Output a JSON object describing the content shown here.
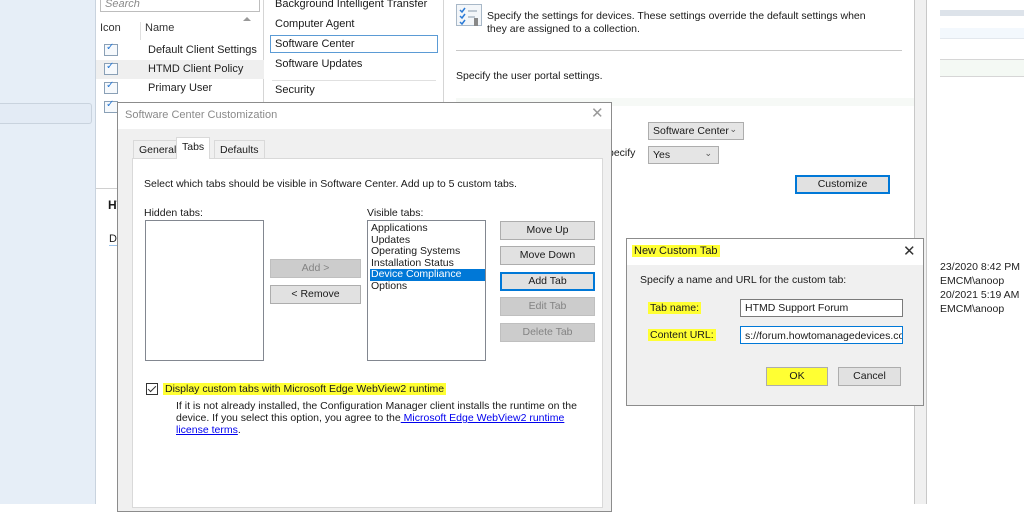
{
  "console": {
    "search_placeholder": "Search",
    "columns": {
      "icon": "Icon",
      "name": "Name"
    },
    "client_settings": [
      {
        "name": "Default Client Settings",
        "selected": false
      },
      {
        "name": "HTMD Client Policy",
        "selected": true
      },
      {
        "name": "Primary User",
        "selected": false
      }
    ],
    "details_title": "HT",
    "details_tab": "D"
  },
  "categories": {
    "items": [
      "Background Intelligent Transfer",
      "Computer Agent",
      "Software Center",
      "Software Updates",
      "Security"
    ],
    "selected": "Software Center"
  },
  "device_settings": {
    "description": "Specify the settings for devices. These settings override the default settings when they are assigned to a collection.",
    "portal_text": "Specify the user portal settings.",
    "partial_label": "pecify",
    "portal_combo": "Software Center",
    "specify_combo": "Yes",
    "customize_button": "Customize"
  },
  "right_pane": {
    "lines": [
      "23/2020 8:42 PM",
      "EMCM\\anoop",
      "20/2021 5:19 AM",
      "EMCM\\anoop"
    ]
  },
  "scc_dialog": {
    "title": "Software Center Customization",
    "tabs": [
      {
        "label": "General",
        "active": false
      },
      {
        "label": "Tabs",
        "active": true
      },
      {
        "label": "Defaults",
        "active": false
      }
    ],
    "intro": "Select which tabs should be visible in Software Center. Add up to 5 custom tabs.",
    "hidden_label": "Hidden tabs:",
    "visible_label": "Visible tabs:",
    "hidden_tabs": [],
    "visible_tabs": [
      "Applications",
      "Updates",
      "Operating Systems",
      "Installation Status",
      "Device Compliance",
      "Options"
    ],
    "selected_visible_tab": "Device Compliance",
    "buttons": {
      "add": "Add >",
      "remove": "< Remove",
      "move_up": "Move Up",
      "move_down": "Move Down",
      "add_tab": "Add Tab",
      "edit_tab": "Edit Tab",
      "delete_tab": "Delete Tab"
    },
    "webview_checkbox": {
      "label": "Display custom tabs with Microsoft Edge WebView2 runtime",
      "checked": true,
      "help_text": "If it is not already installed, the Configuration Manager client installs the runtime on the device. If you select this option, you agree to the",
      "link_text": " Microsoft Edge WebView2 runtime license terms",
      "trailing": "."
    }
  },
  "nct_dialog": {
    "title": "New Custom Tab",
    "intro": "Specify a name and URL for the custom tab:",
    "tab_name_label": "Tab name:",
    "tab_name_value": "HTMD Support Forum",
    "content_url_label": "Content URL:",
    "content_url_value": "s://forum.howtomanagedevices.com/",
    "ok": "OK",
    "cancel": "Cancel"
  },
  "colors": {
    "highlight": "#ffff33",
    "selection": "#0078d7",
    "link": "#0000ee"
  }
}
